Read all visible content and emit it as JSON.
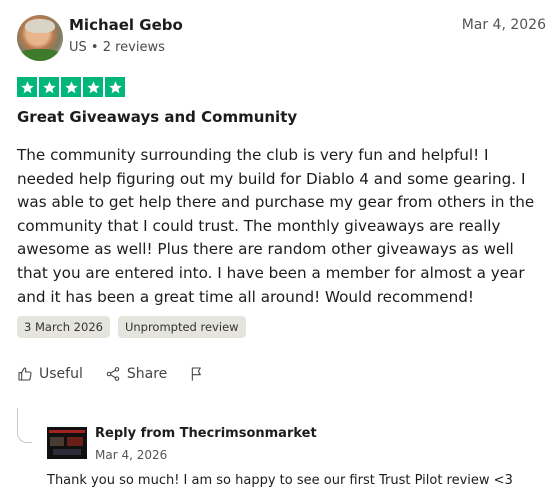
{
  "review": {
    "author": "Michael Gebo",
    "meta": "US • 2 reviews",
    "date": "Mar 4, 2026",
    "rating": 5,
    "star_color": "#00b67a",
    "title": "Great Giveaways and Community",
    "body": "The community surrounding the club is very fun and helpful! I needed help figuring out my build for Diablo 4 and some gearing. I was able to get help there and purchase my gear from others in the community that I could trust. The monthly giveaways are really awesome as well! Plus there are random other giveaways as well that you are entered into. I have been a member for almost a year and it has been a great time all around! Would recommend!",
    "experience_date": "3 March 2026",
    "tag": "Unprompted review"
  },
  "actions": {
    "useful": "Useful",
    "share": "Share"
  },
  "reply": {
    "from": "Reply from Thecrimsonmarket",
    "date": "Mar 4, 2026",
    "text": "Thank you so much! I am so happy to see our first Trust Pilot review <3"
  }
}
